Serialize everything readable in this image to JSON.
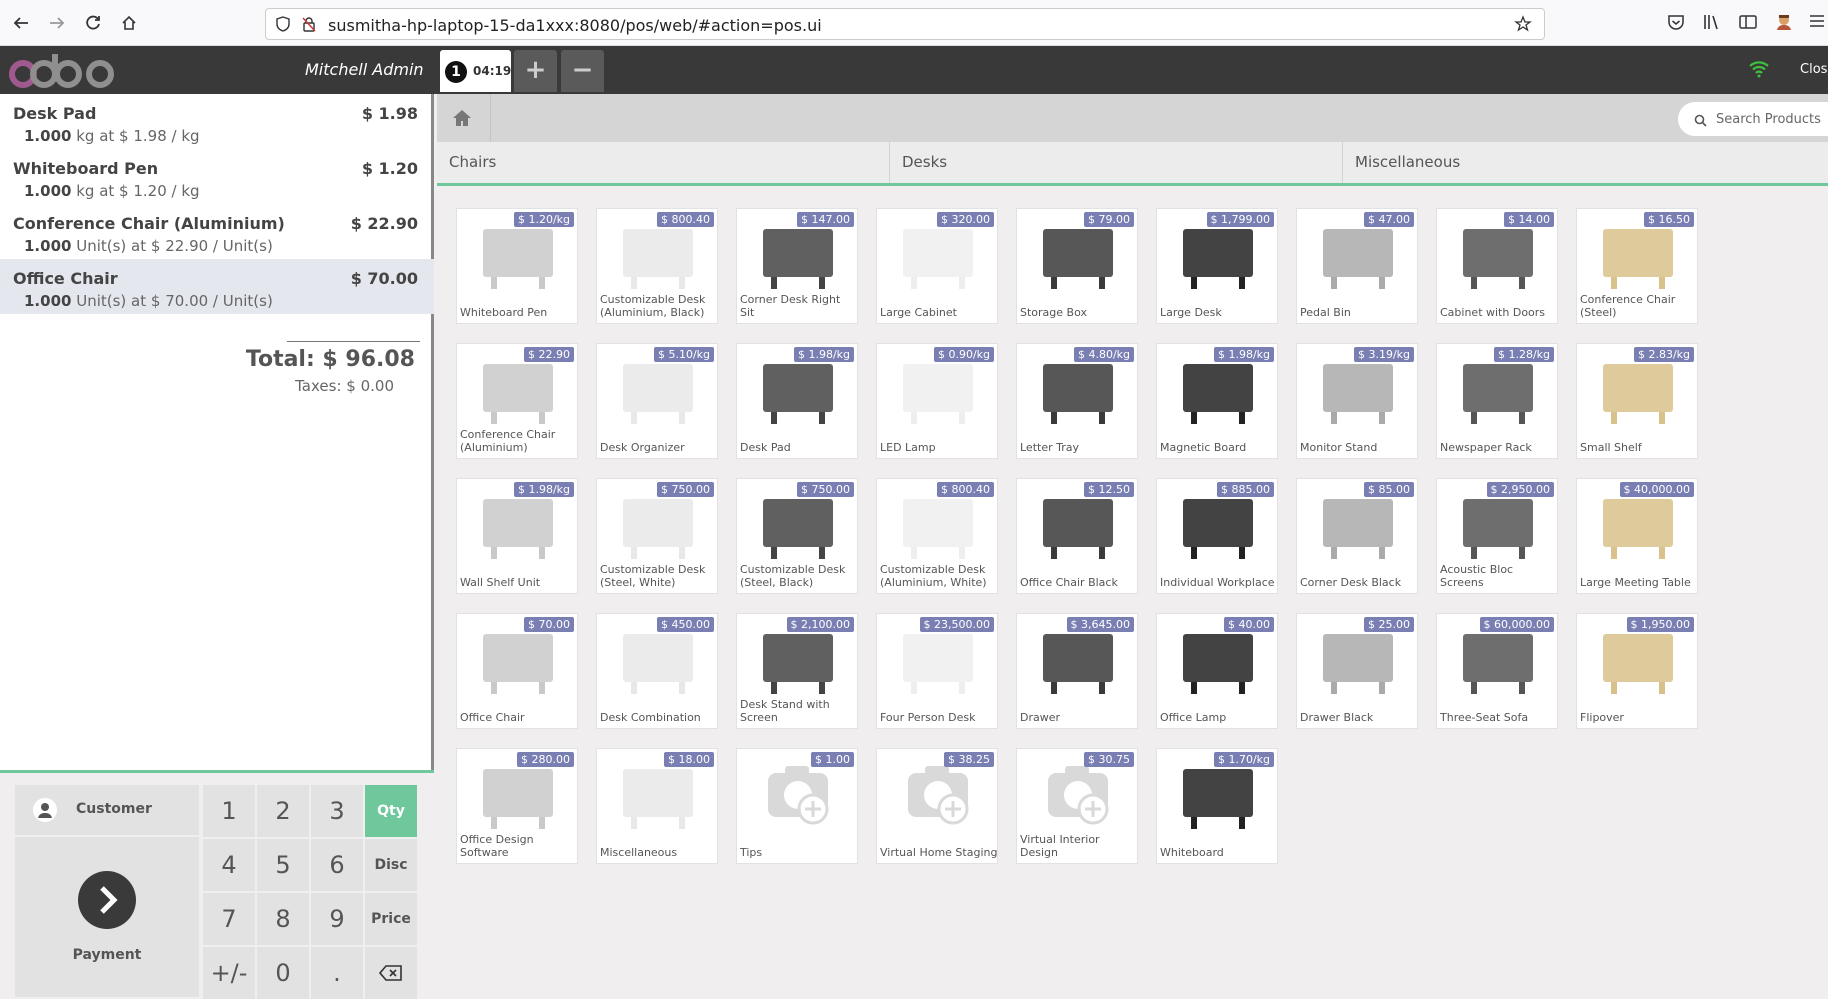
{
  "browser": {
    "url": "susmitha-hp-laptop-15-da1xxx:8080/pos/web/#action=pos.ui"
  },
  "header": {
    "user": "Mitchell Admin",
    "order_number": "1",
    "order_time": "04:19",
    "add_label": "+",
    "remove_label": "−",
    "close_label": "Close"
  },
  "order": {
    "lines": [
      {
        "name": "Desk Pad",
        "price": "$ 1.98",
        "qty": "1.000",
        "detail": "kg at $ 1.98 / kg"
      },
      {
        "name": "Whiteboard Pen",
        "price": "$ 1.20",
        "qty": "1.000",
        "detail": "kg at $ 1.20 / kg"
      },
      {
        "name": "Conference Chair (Aluminium)",
        "price": "$ 22.90",
        "qty": "1.000",
        "detail": "Unit(s) at $ 22.90 / Unit(s)"
      },
      {
        "name": "Office Chair",
        "price": "$ 70.00",
        "qty": "1.000",
        "detail": "Unit(s) at $ 70.00 / Unit(s)"
      }
    ],
    "total": "Total: $ 96.08",
    "taxes": "Taxes: $ 0.00"
  },
  "pad": {
    "customer": "Customer",
    "payment": "Payment",
    "keys": [
      "1",
      "2",
      "3",
      "4",
      "5",
      "6",
      "7",
      "8",
      "9",
      "+/-",
      "0",
      "."
    ],
    "qty": "Qty",
    "disc": "Disc",
    "price": "Price"
  },
  "search": {
    "placeholder": "Search Products"
  },
  "categories": [
    "Chairs",
    "Desks",
    "Miscellaneous"
  ],
  "products": [
    {
      "name": "Whiteboard Pen",
      "price": "$ 1.20/kg"
    },
    {
      "name": "Customizable Desk (Aluminium, Black)",
      "price": "$ 800.40"
    },
    {
      "name": "Corner Desk Right Sit",
      "price": "$ 147.00"
    },
    {
      "name": "Large Cabinet",
      "price": "$ 320.00"
    },
    {
      "name": "Storage Box",
      "price": "$ 79.00"
    },
    {
      "name": "Large Desk",
      "price": "$ 1,799.00"
    },
    {
      "name": "Pedal Bin",
      "price": "$ 47.00"
    },
    {
      "name": "Cabinet with Doors",
      "price": "$ 14.00"
    },
    {
      "name": "Conference Chair (Steel)",
      "price": "$ 16.50"
    },
    {
      "name": "Conference Chair (Aluminium)",
      "price": "$ 22.90"
    },
    {
      "name": "Desk Organizer",
      "price": "$ 5.10/kg"
    },
    {
      "name": "Desk Pad",
      "price": "$ 1.98/kg"
    },
    {
      "name": "LED Lamp",
      "price": "$ 0.90/kg"
    },
    {
      "name": "Letter Tray",
      "price": "$ 4.80/kg"
    },
    {
      "name": "Magnetic Board",
      "price": "$ 1.98/kg"
    },
    {
      "name": "Monitor Stand",
      "price": "$ 3.19/kg"
    },
    {
      "name": "Newspaper Rack",
      "price": "$ 1.28/kg"
    },
    {
      "name": "Small Shelf",
      "price": "$ 2.83/kg"
    },
    {
      "name": "Wall Shelf Unit",
      "price": "$ 1.98/kg"
    },
    {
      "name": "Customizable Desk (Steel, White)",
      "price": "$ 750.00"
    },
    {
      "name": "Customizable Desk (Steel, Black)",
      "price": "$ 750.00"
    },
    {
      "name": "Customizable Desk (Aluminium, White)",
      "price": "$ 800.40"
    },
    {
      "name": "Office Chair Black",
      "price": "$ 12.50"
    },
    {
      "name": "Individual Workplace",
      "price": "$ 885.00"
    },
    {
      "name": "Corner Desk Black",
      "price": "$ 85.00"
    },
    {
      "name": "Acoustic Bloc Screens",
      "price": "$ 2,950.00"
    },
    {
      "name": "Large Meeting Table",
      "price": "$ 40,000.00"
    },
    {
      "name": "Office Chair",
      "price": "$ 70.00"
    },
    {
      "name": "Desk Combination",
      "price": "$ 450.00"
    },
    {
      "name": "Desk Stand with Screen",
      "price": "$ 2,100.00"
    },
    {
      "name": "Four Person Desk",
      "price": "$ 23,500.00"
    },
    {
      "name": "Drawer",
      "price": "$ 3,645.00"
    },
    {
      "name": "Office Lamp",
      "price": "$ 40.00"
    },
    {
      "name": "Drawer Black",
      "price": "$ 25.00"
    },
    {
      "name": "Three-Seat Sofa",
      "price": "$ 60,000.00"
    },
    {
      "name": "Flipover",
      "price": "$ 1,950.00"
    },
    {
      "name": "Office Design Software",
      "price": "$ 280.00"
    },
    {
      "name": "Miscellaneous",
      "price": "$ 18.00"
    },
    {
      "name": "Tips",
      "price": "$ 1.00"
    },
    {
      "name": "Virtual Home Staging",
      "price": "$ 38.25"
    },
    {
      "name": "Virtual Interior Design",
      "price": "$ 30.75"
    },
    {
      "name": "Whiteboard",
      "price": "$ 1.70/kg"
    }
  ]
}
